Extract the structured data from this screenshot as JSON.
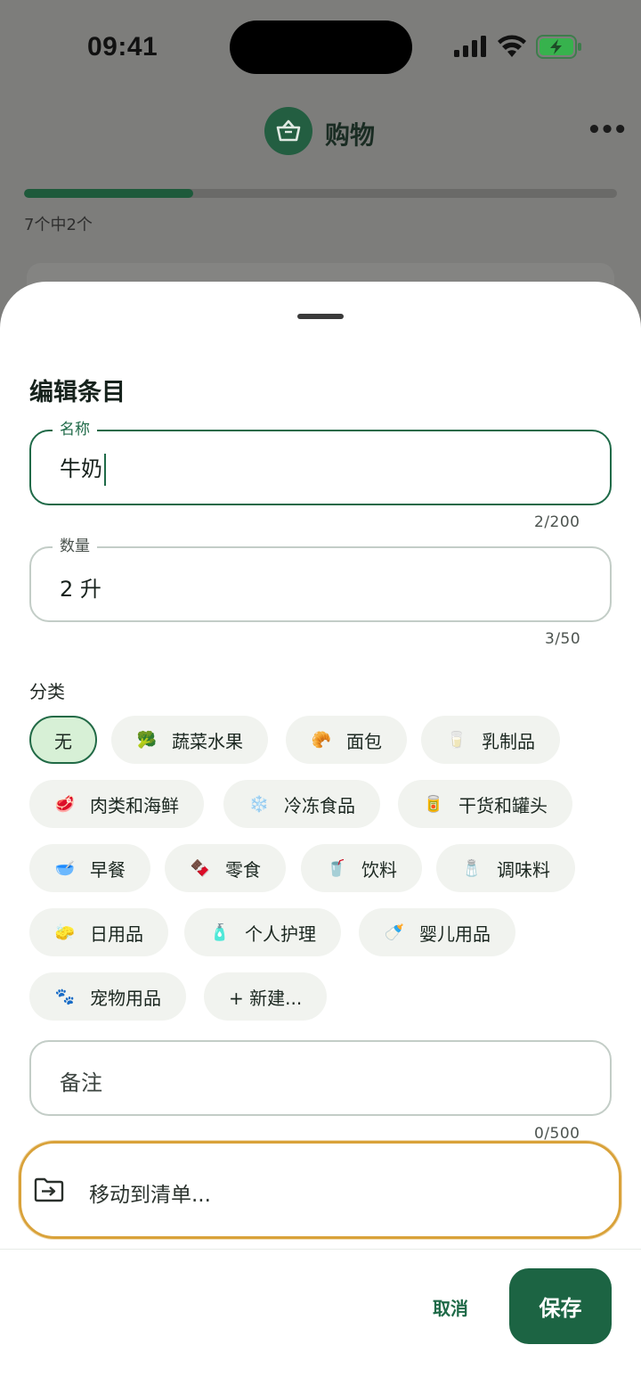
{
  "status_bar": {
    "time": "09:41"
  },
  "app": {
    "title": "购物",
    "progress_text": "7个中2个",
    "progress_fraction": 0.286
  },
  "sheet": {
    "title": "编辑条目",
    "name_field": {
      "label": "名称",
      "value": "牛奶",
      "counter": "2/200"
    },
    "quantity_field": {
      "label": "数量",
      "value": "2 升",
      "counter": "3/50"
    },
    "category_label": "分类",
    "categories": [
      {
        "label": "无",
        "icon": "",
        "selected": true
      },
      {
        "label": "蔬菜水果",
        "icon": "🥦",
        "selected": false
      },
      {
        "label": "面包",
        "icon": "🥐",
        "selected": false
      },
      {
        "label": "乳制品",
        "icon": "🥛",
        "selected": false
      },
      {
        "label": "肉类和海鲜",
        "icon": "🥩",
        "selected": false
      },
      {
        "label": "冷冻食品",
        "icon": "❄️",
        "selected": false
      },
      {
        "label": "干货和罐头",
        "icon": "🥫",
        "selected": false
      },
      {
        "label": "早餐",
        "icon": "🥣",
        "selected": false
      },
      {
        "label": "零食",
        "icon": "🍫",
        "selected": false
      },
      {
        "label": "饮料",
        "icon": "🥤",
        "selected": false
      },
      {
        "label": "调味料",
        "icon": "🧂",
        "selected": false
      },
      {
        "label": "日用品",
        "icon": "🧽",
        "selected": false
      },
      {
        "label": "个人护理",
        "icon": "🧴",
        "selected": false
      },
      {
        "label": "婴儿用品",
        "icon": "🍼",
        "selected": false
      },
      {
        "label": "宠物用品",
        "icon": "🐾",
        "selected": false
      },
      {
        "label": "+ 新建...",
        "icon": "",
        "selected": false
      }
    ],
    "notes_field": {
      "placeholder": "备注",
      "counter": "0/500"
    },
    "move_to_list": "移动到清单...",
    "cancel_label": "取消",
    "save_label": "保存"
  },
  "colors": {
    "accent": "#1c6443",
    "selected_chip_bg": "#d7f0d6",
    "highlight_outline": "#d9a23a",
    "scrim": "#7d7d7b"
  }
}
